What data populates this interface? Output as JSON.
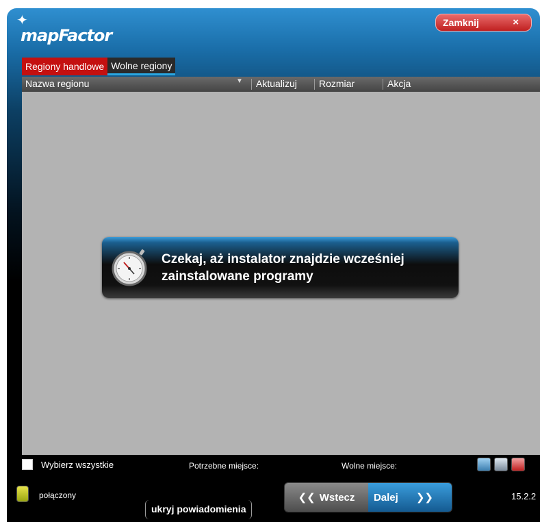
{
  "app": {
    "logo_text": "mapFactor"
  },
  "header": {
    "close_label": "Zamknij",
    "close_icon": "×"
  },
  "tabs": [
    {
      "label": "Regiony handlowe",
      "active": true
    },
    {
      "label": "Wolne regiony",
      "active": false
    }
  ],
  "list": {
    "columns": {
      "name": "Nazwa regionu",
      "update": "Aktualizuj",
      "size": "Rozmiar",
      "action": "Akcja"
    },
    "rows": []
  },
  "dialog": {
    "message": "Czekaj, aż instalator znajdzie wcześniej zainstalowane programy",
    "icon": "stopwatch-icon"
  },
  "footer": {
    "select_all_label": "Wybierz wszystkie",
    "space_needed_label": "Potrzebne miejsce:",
    "space_free_label": "Wolne miejsce:",
    "status_label": "połączony",
    "hide_notifications_label": "ukryj powiadomienia",
    "back_label": "Wstecz",
    "next_label": "Dalej",
    "version": "15.2.2"
  },
  "colors": {
    "active_tab": "#c41010",
    "header_blue": "#2f8fd0",
    "list_background": "#b3b3b3",
    "next_button": "#2a86c4"
  }
}
